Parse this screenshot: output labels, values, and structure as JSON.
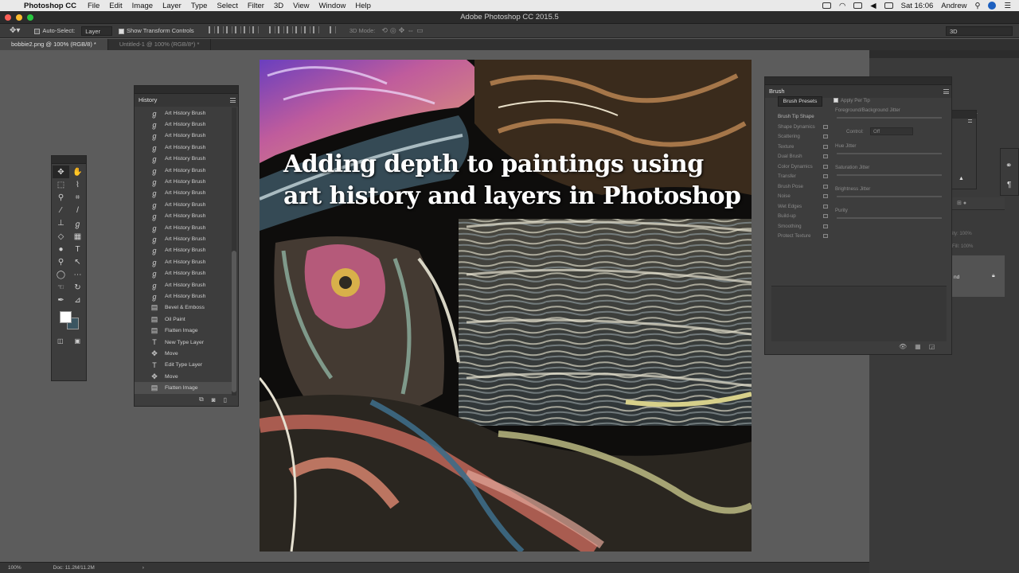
{
  "menubar": {
    "app_name": "Photoshop CC",
    "items": [
      "File",
      "Edit",
      "Image",
      "Layer",
      "Type",
      "Select",
      "Filter",
      "3D",
      "View",
      "Window",
      "Help"
    ],
    "clock": "Sat 16:06",
    "user": "Andrew"
  },
  "window": {
    "title": "Adobe Photoshop CC 2015.5"
  },
  "options": {
    "auto_select_label": "Auto-Select:",
    "auto_select_value": "Layer",
    "show_transform_label": "Show Transform Controls",
    "mode_3d_label": "3D Mode:",
    "workspace_value": "3D"
  },
  "tabs": [
    {
      "label": "bobbie2.png @ 100% (RGB/8) *"
    },
    {
      "label": "Untitled-1 @ 100% (RGB/8*) *"
    }
  ],
  "canvas": {
    "title_line1": "Adding depth to paintings using",
    "title_line2": "art history and layers in Photoshop"
  },
  "history": {
    "title": "History",
    "rows": [
      {
        "label": "Art History Brush",
        "icon": "art-history-brush-icon"
      },
      {
        "label": "Art History Brush",
        "icon": "art-history-brush-icon"
      },
      {
        "label": "Art History Brush",
        "icon": "art-history-brush-icon"
      },
      {
        "label": "Art History Brush",
        "icon": "art-history-brush-icon"
      },
      {
        "label": "Art History Brush",
        "icon": "art-history-brush-icon"
      },
      {
        "label": "Art History Brush",
        "icon": "art-history-brush-icon"
      },
      {
        "label": "Art History Brush",
        "icon": "art-history-brush-icon"
      },
      {
        "label": "Art History Brush",
        "icon": "art-history-brush-icon"
      },
      {
        "label": "Art History Brush",
        "icon": "art-history-brush-icon"
      },
      {
        "label": "Art History Brush",
        "icon": "art-history-brush-icon"
      },
      {
        "label": "Art History Brush",
        "icon": "art-history-brush-icon"
      },
      {
        "label": "Art History Brush",
        "icon": "art-history-brush-icon"
      },
      {
        "label": "Art History Brush",
        "icon": "art-history-brush-icon"
      },
      {
        "label": "Art History Brush",
        "icon": "art-history-brush-icon"
      },
      {
        "label": "Art History Brush",
        "icon": "art-history-brush-icon"
      },
      {
        "label": "Art History Brush",
        "icon": "art-history-brush-icon"
      },
      {
        "label": "Art History Brush",
        "icon": "art-history-brush-icon"
      },
      {
        "label": "Bevel & Emboss",
        "icon": "filter-icon"
      },
      {
        "label": "Oil Paint",
        "icon": "filter-icon"
      },
      {
        "label": "Flatten Image",
        "icon": "filter-icon"
      },
      {
        "label": "New Type Layer",
        "icon": "type-icon"
      },
      {
        "label": "Move",
        "icon": "move-icon"
      },
      {
        "label": "Edit Type Layer",
        "icon": "type-icon"
      },
      {
        "label": "Move",
        "icon": "move-icon"
      },
      {
        "label": "Flatten Image",
        "icon": "filter-icon"
      }
    ]
  },
  "brush": {
    "title": "Brush",
    "presets_button": "Brush Presets",
    "apply_per_tip": "Apply Per Tip",
    "fg_bg_jitter": "Foreground/Background Jitter",
    "control_label": "Control:",
    "control_value": "Off",
    "hue_jitter": "Hue Jitter",
    "saturation_jitter": "Saturation Jitter",
    "brightness_jitter": "Brightness Jitter",
    "purity": "Purity",
    "items": [
      "Brush Tip Shape",
      "Shape Dynamics",
      "Scattering",
      "Texture",
      "Dual Brush",
      "Color Dynamics",
      "Transfer",
      "Brush Pose",
      "Noise",
      "Wet Edges",
      "Build-up",
      "Smoothing",
      "Protect Texture"
    ]
  },
  "layers_peek": {
    "opacity_label": "ity:",
    "opacity_value": "100%",
    "fill_label": "Fill:",
    "fill_value": "100%",
    "layer_name": "nd"
  },
  "status": {
    "zoom": "100%",
    "doc": "Doc: 11.2M/11.2M"
  }
}
